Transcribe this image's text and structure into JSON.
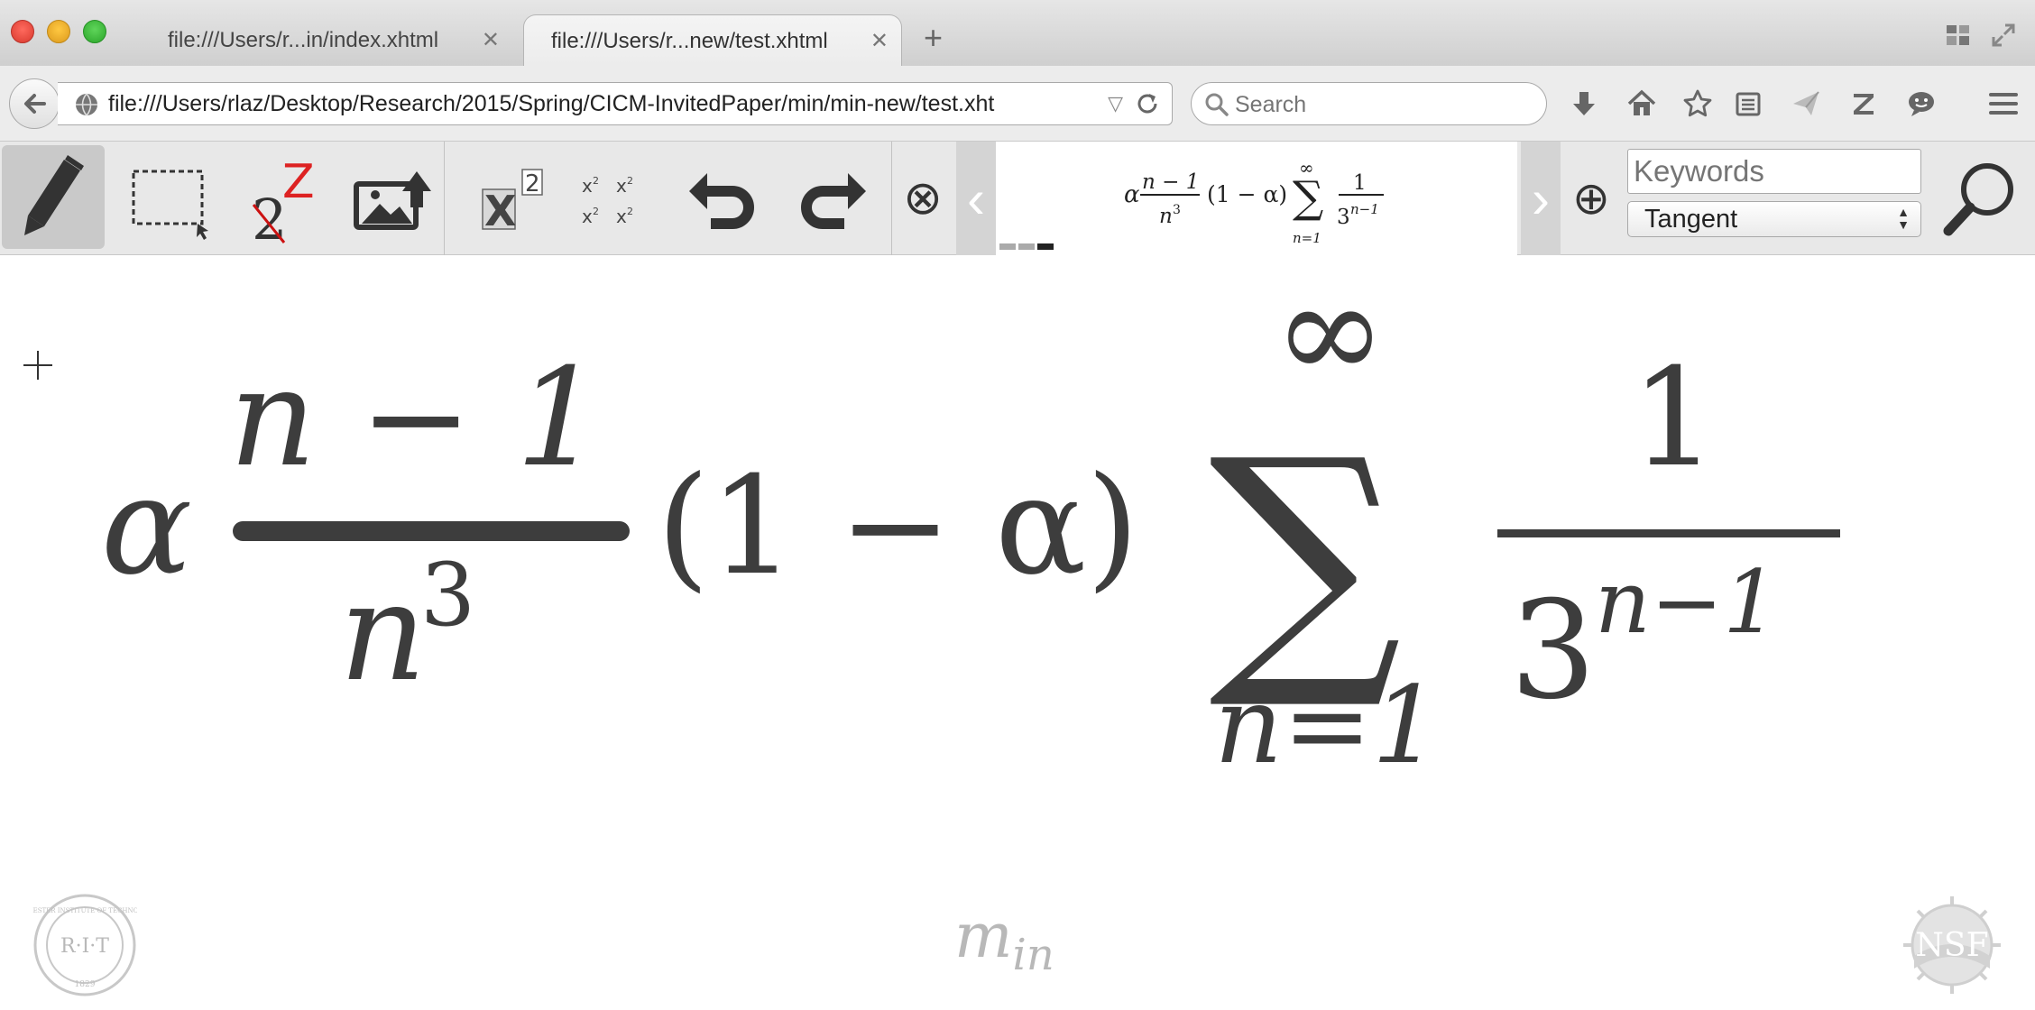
{
  "browser": {
    "tabs": [
      {
        "label": "file:///Users/r...in/index.xhtml",
        "active": false
      },
      {
        "label": "file:///Users/r...new/test.xhtml",
        "active": true
      }
    ],
    "new_tab_label": "+",
    "tab_close_glyph": "✕",
    "url": "file:///Users/rlaz/Desktop/Research/2015/Spring/CICM-InvitedPaper/min/min-new/test.xht",
    "search_placeholder": "Search",
    "toolbar_icons": [
      "download-icon",
      "home-icon",
      "bookmark-star-icon",
      "reading-list-icon",
      "send-icon",
      "zotero-icon",
      "chat-icon",
      "menu-icon"
    ]
  },
  "min_toolbar": {
    "tools": [
      "pen-icon",
      "rectangle-select-icon",
      "symbol-correction-icon",
      "image-upload-icon",
      "superscript-icon",
      "matrix-icon",
      "undo-icon",
      "redo-icon",
      "clear-icon"
    ],
    "superscript_exp": "2",
    "preview_prev": "‹",
    "preview_next": "›",
    "add_glyph": "⊕",
    "clear_glyph": "⊗",
    "keywords_placeholder": "Keywords",
    "search_mode": "Tangent",
    "preview_page": 3,
    "preview_page_count": 3
  },
  "formula": {
    "alpha": "α",
    "num": "n − 1",
    "den_base": "n",
    "den_exp": "3",
    "paren": "(1 − α)",
    "sigma": "∑",
    "upper": "∞",
    "lower": "n=1",
    "frac2_num": "1",
    "frac2_den_base": "3",
    "frac2_den_exp": "n−1"
  },
  "canvas": {
    "app_logo_main": "m",
    "app_logo_sub": "in",
    "rit_seal_text": "R·I·T",
    "rit_seal_ring": "ROCHESTER INSTITUTE OF TECHNOLOGY",
    "rit_seal_year": "1829",
    "nsf_seal_text": "NSF"
  }
}
